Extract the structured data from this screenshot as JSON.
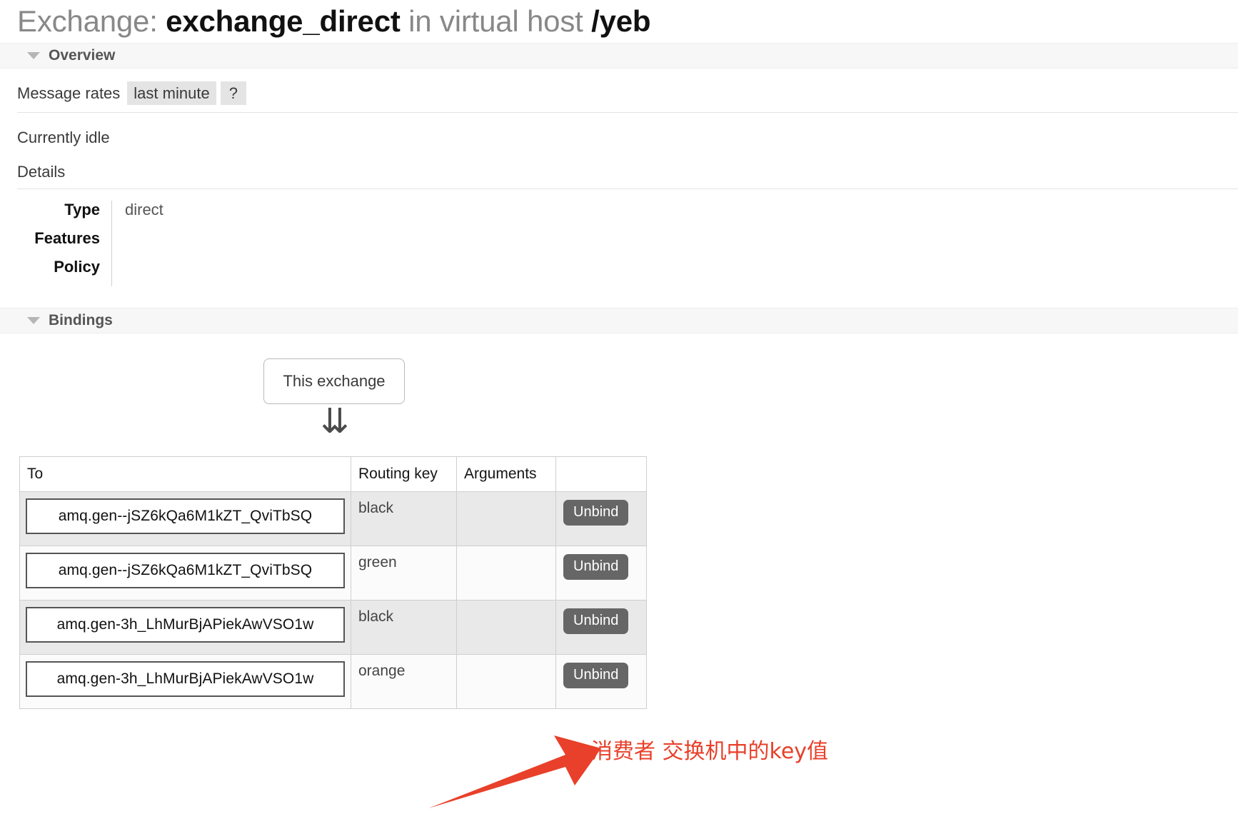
{
  "page": {
    "title_prefix": "Exchange:",
    "title_name": "exchange_direct",
    "title_middle": "in virtual host",
    "title_vhost": "/yeb"
  },
  "overview": {
    "section_label": "Overview",
    "collapse_icon": "triangle-down-icon",
    "message_rates_label": "Message rates",
    "period_chip": "last minute",
    "help_chip": "?",
    "idle_text": "Currently idle",
    "details_label": "Details",
    "details": [
      {
        "key": "Type",
        "value": "direct"
      },
      {
        "key": "Features",
        "value": ""
      },
      {
        "key": "Policy",
        "value": ""
      }
    ]
  },
  "bindings": {
    "section_label": "Bindings",
    "collapse_icon": "triangle-down-icon",
    "this_exchange_label": "This exchange",
    "flow_arrow": "⇊",
    "annotation": {
      "text": "消费者 交换机中的key值",
      "color": "#e8402a"
    },
    "table": {
      "headers": [
        "To",
        "Routing key",
        "Arguments",
        ""
      ],
      "rows": [
        {
          "to": "amq.gen--jSZ6kQa6M1kZT_QviTbSQ",
          "routing_key": "black",
          "arguments": "",
          "action": "Unbind"
        },
        {
          "to": "amq.gen--jSZ6kQa6M1kZT_QviTbSQ",
          "routing_key": "green",
          "arguments": "",
          "action": "Unbind"
        },
        {
          "to": "amq.gen-3h_LhMurBjAPiekAwVSO1w",
          "routing_key": "black",
          "arguments": "",
          "action": "Unbind"
        },
        {
          "to": "amq.gen-3h_LhMurBjAPiekAwVSO1w",
          "routing_key": "orange",
          "arguments": "",
          "action": "Unbind"
        }
      ]
    }
  }
}
